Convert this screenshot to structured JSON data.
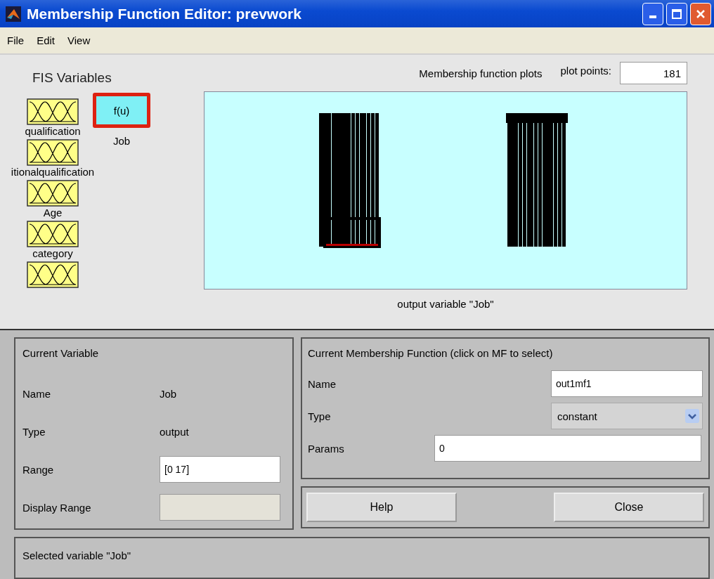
{
  "window": {
    "title": "Membership Function Editor: prevwork"
  },
  "menu": [
    "File",
    "Edit",
    "View"
  ],
  "fis_variables": {
    "title": "FIS Variables",
    "inputs": [
      {
        "label": "qualification",
        "selected": false
      },
      {
        "label": "itionalqualification",
        "selected": false
      },
      {
        "label": "Age",
        "selected": false
      },
      {
        "label": "category",
        "selected": false
      },
      {
        "selected": false
      }
    ],
    "outputs": [
      {
        "label": "Job",
        "icon_text": "f(u)",
        "selected": true
      }
    ]
  },
  "plot": {
    "title": "Membership function plots",
    "points_label": "plot points:",
    "points_value": "181",
    "caption": "output variable \"Job\""
  },
  "current_variable": {
    "title": "Current Variable",
    "fields": [
      {
        "kind": "text",
        "label": "Name",
        "value": "Job"
      },
      {
        "kind": "text",
        "label": "Type",
        "value": "output"
      },
      {
        "kind": "input",
        "label": "Range",
        "value": "[0 17]",
        "disabled": false
      },
      {
        "kind": "input",
        "label": "Display Range",
        "disabled": true
      }
    ]
  },
  "current_mf": {
    "title": "Current Membership Function (click on MF to select)",
    "fields": [
      {
        "kind": "input",
        "label": "Name",
        "value": "out1mf1"
      },
      {
        "kind": "select",
        "label": "Type",
        "value": "constant"
      },
      {
        "kind": "wide",
        "label": "Params",
        "value": "0"
      }
    ]
  },
  "buttons": [
    "Help",
    "Close"
  ],
  "status_bar": "Selected variable \"Job\""
}
